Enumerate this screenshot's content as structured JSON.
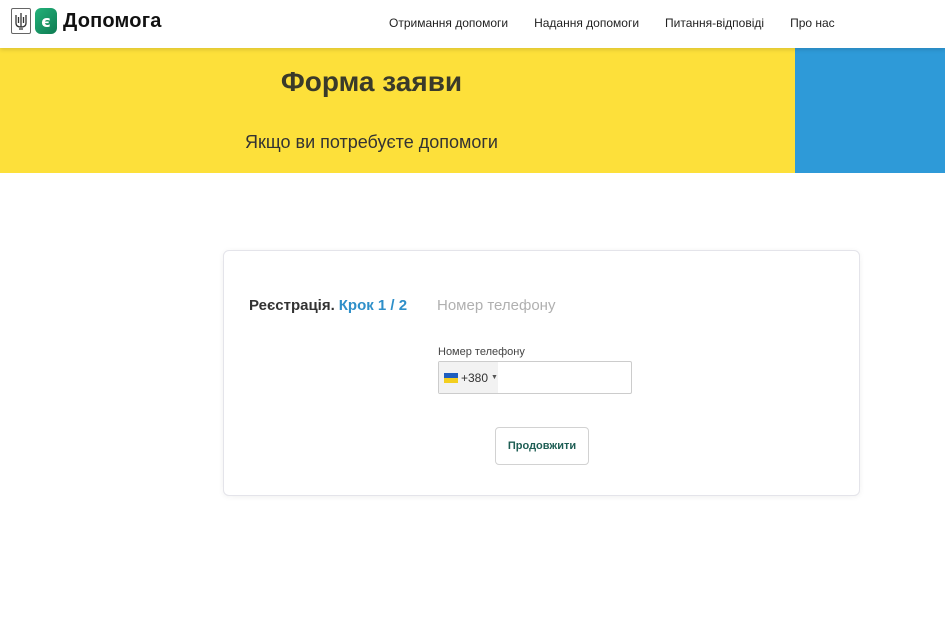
{
  "header": {
    "brand_letter": "є",
    "brand_name": "Допомога",
    "nav": [
      {
        "label": "Отримання допомоги"
      },
      {
        "label": "Надання допомоги"
      },
      {
        "label": "Питання-відповіді"
      },
      {
        "label": "Про нас"
      }
    ]
  },
  "hero": {
    "title": "Форма заяви",
    "subtitle": "Якщо ви потребуєте допомоги",
    "colors": {
      "yellow": "#fde03a",
      "blue": "#2e9ad8"
    }
  },
  "form": {
    "step_label": "Реєстрація.",
    "step_count": "Крок 1 / 2",
    "step_name": "Номер телефону",
    "phone": {
      "label": "Номер телефону",
      "country_code": "+380",
      "flag_icon": "ukraine-flag-icon",
      "value": "",
      "placeholder": ""
    },
    "submit_label": "Продовжити"
  }
}
